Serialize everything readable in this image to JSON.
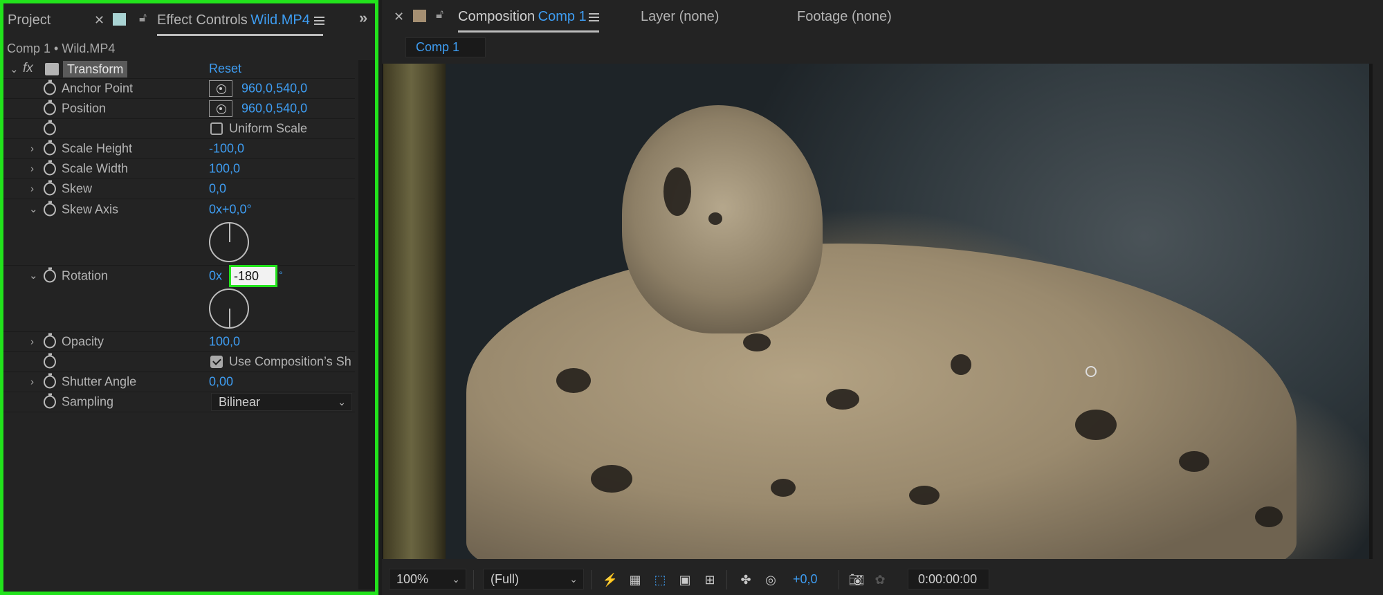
{
  "left_panel": {
    "tab_project": "Project",
    "tab_effect_controls": "Effect Controls",
    "tab_effect_controls_target": "Wild.MP4",
    "subheader": "Comp 1 • Wild.MP4",
    "effect": {
      "fx_label": "fx",
      "name": "Transform",
      "reset_label": "Reset"
    },
    "properties": {
      "anchor_point": {
        "label": "Anchor Point",
        "x": "960,0",
        "comma": ",",
        "y": "540,0"
      },
      "position": {
        "label": "Position",
        "x": "960,0",
        "comma": ",",
        "y": "540,0"
      },
      "uniform_scale": {
        "label": "Uniform Scale",
        "checked": false
      },
      "scale_height": {
        "label": "Scale Height",
        "value": "-100,0"
      },
      "scale_width": {
        "label": "Scale Width",
        "value": "100,0"
      },
      "skew": {
        "label": "Skew",
        "value": "0,0"
      },
      "skew_axis": {
        "label": "Skew Axis",
        "value": "0x+0,0°"
      },
      "rotation": {
        "label": "Rotation",
        "revolutions": "0x",
        "input_value": "-180",
        "degree_symbol": "°"
      },
      "opacity": {
        "label": "Opacity",
        "value": "100,0"
      },
      "use_comp_shutter": {
        "label": "Use Composition’s Sh",
        "checked": true
      },
      "shutter_angle": {
        "label": "Shutter Angle",
        "value": "0,00"
      },
      "sampling": {
        "label": "Sampling",
        "value": "Bilinear"
      }
    }
  },
  "right_panel": {
    "tab_composition": "Composition",
    "tab_composition_target": "Comp 1",
    "tab_layer": "Layer (none)",
    "tab_footage": "Footage (none)",
    "comp_subtab": "Comp 1",
    "bottom_bar": {
      "zoom": "100%",
      "resolution": "(Full)",
      "exposure": "+0,0",
      "timecode": "0:00:00:00"
    }
  },
  "icons": {
    "close": "close-icon",
    "lock": "lock-icon",
    "menu": "panel-menu-icon",
    "expand": "double-chevron-right-icon",
    "stopwatch": "stopwatch-icon",
    "target": "crosshair-target-icon",
    "camera": "camera-snapshot-icon"
  },
  "colors": {
    "accent_blue": "#3e9df2",
    "keyframe_red": "#e04a3c",
    "highlight_green": "#22e31c",
    "panel_bg": "#232323"
  }
}
